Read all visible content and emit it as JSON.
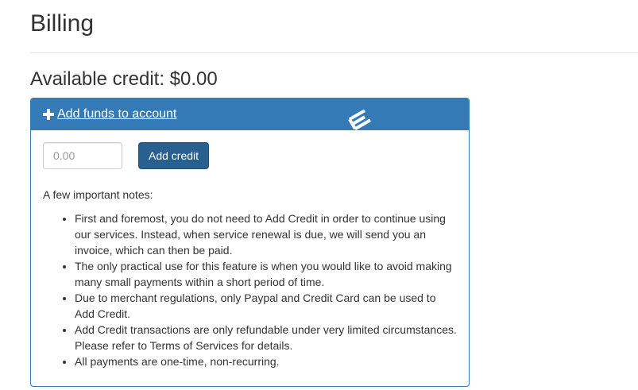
{
  "page": {
    "title": "Billing",
    "available_credit_label": "Available credit: $0.00"
  },
  "panel": {
    "heading_icon": "plus-icon",
    "heading_label": "Add funds to account",
    "input": {
      "placeholder": "0.00",
      "value": ""
    },
    "add_button_label": "Add credit",
    "notes_label": "A few important notes:",
    "notes": [
      "First and foremost, you do not need to Add Credit in order to continue using our services. Instead, when service renewal is due, we will send you an invoice, which can then be paid.",
      "The only practical use for this feature is when you would like to avoid making many small payments within a short period of time.",
      "Due to merchant regulations, only Paypal and Credit Card can be used to Add Credit.",
      "Add Credit transactions are only refundable under very limited circumstances. Please refer to Terms of Services for details.",
      "All payments are one-time, non-recurring."
    ]
  },
  "colors": {
    "panel_primary": "#337ab7",
    "button_primary": "#286090",
    "text": "#333333"
  }
}
